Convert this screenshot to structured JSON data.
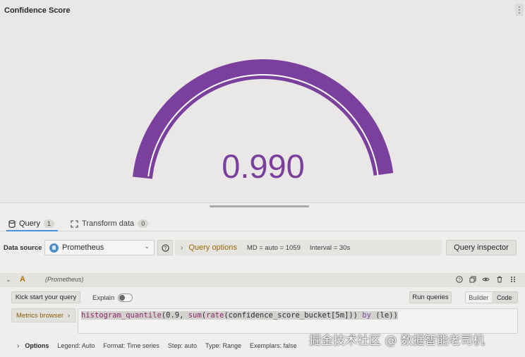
{
  "panel": {
    "title": "Confidence Score",
    "menu_icon": "kebab-vertical-icon",
    "gauge": {
      "value": 0.99,
      "display": "0.990",
      "min": 0,
      "max": 1,
      "color": "#7b3f9e",
      "track_color": "#ffffff"
    }
  },
  "tabs": [
    {
      "label": "Query",
      "count": "1",
      "icon": "database-icon",
      "active": true
    },
    {
      "label": "Transform data",
      "count": "0",
      "icon": "transform-icon",
      "active": false
    }
  ],
  "datasource": {
    "label": "Data source",
    "selected": "Prometheus",
    "icon": "prometheus-logo",
    "help_icon": "question-circle-icon"
  },
  "query_options": {
    "title": "Query options",
    "md": "MD = auto = 1059",
    "interval": "Interval = 30s"
  },
  "query_inspector_label": "Query inspector",
  "query": {
    "ref_id": "A",
    "datasource_name": "(Prometheus)",
    "kick_start_label": "Kick start your query",
    "explain_label": "Explain",
    "explain_enabled": false,
    "run_label": "Run queries",
    "modes": [
      "Builder",
      "Code"
    ],
    "active_mode": "Code",
    "metrics_browser_label": "Metrics browser",
    "expression": {
      "fn1": "histogram_quantile",
      "p1": "(0.9, ",
      "fn2": "sum",
      "p2": "(",
      "fn3": "rate",
      "p3": "(confidence_score_bucket[5m])) ",
      "kw": "by",
      "p4": " (le))"
    },
    "options": {
      "title": "Options",
      "legend": "Legend: Auto",
      "format": "Format: Time series",
      "step": "Step: auto",
      "type": "Type: Range",
      "exemplars": "Exemplars: false"
    }
  },
  "watermark": "掘金技术社区 @ 数据智能老司机"
}
